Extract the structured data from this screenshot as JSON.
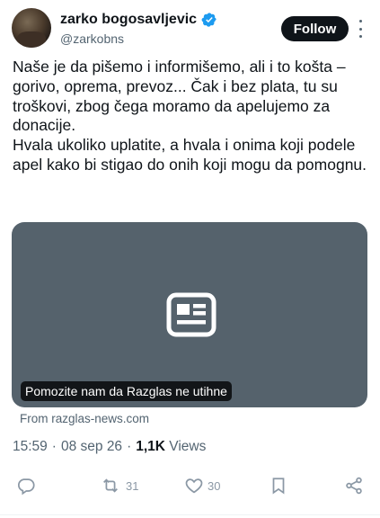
{
  "author": {
    "display_name": "zarko bogosavljevic",
    "handle": "@zarkobns"
  },
  "header": {
    "follow_label": "Follow"
  },
  "tweet": {
    "text": "Naše je da pišemo i informišemo, ali i to košta – gorivo, oprema, prevoz... Čak i bez plata, tu su troškovi, zbog čega moramo da apelujemo za donacije.\nHvala ukoliko uplatite, a hvala i onima koji podele apel kako bi stigao do onih koji mogu da pomognu."
  },
  "card": {
    "title": "Pomozite nam da Razglas ne utihne",
    "source": "From razglas-news.com"
  },
  "meta": {
    "time": "15:59",
    "date": "08 sep 26",
    "views_count": "1,1K",
    "views_label": "Views",
    "separator": "·"
  },
  "actions": {
    "reply_count": "",
    "retweet_count": "31",
    "like_count": "30"
  },
  "colors": {
    "verified_blue": "#1d9bf0",
    "card_bg": "#55626c",
    "muted": "#536471"
  }
}
